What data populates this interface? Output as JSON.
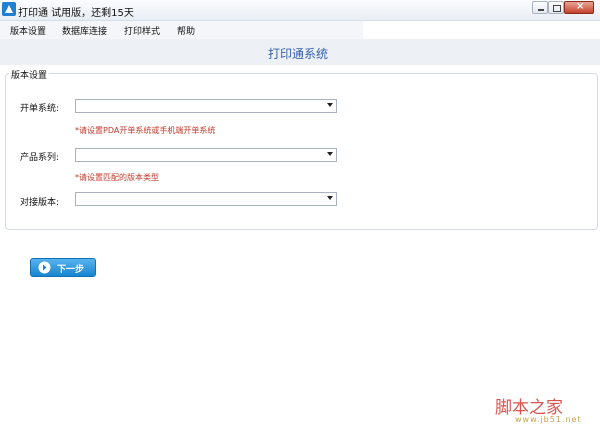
{
  "window": {
    "title": "打印通  试用版，还剩15天",
    "icon": "app-logo-icon",
    "controls": {
      "minimize": "minimize-icon",
      "maximize": "maximize-icon",
      "close": "×"
    }
  },
  "menu": {
    "items": [
      {
        "label": "版本设置"
      },
      {
        "label": "数据库连接"
      },
      {
        "label": "打印样式"
      },
      {
        "label": "帮助"
      }
    ]
  },
  "header": {
    "title": "打印通系统"
  },
  "version_settings": {
    "legend": "版本设置",
    "fields": [
      {
        "label": "开单系统:",
        "value": "",
        "hint": "*请设置PDA开单系统或手机端开单系统"
      },
      {
        "label": "产品系列:",
        "value": "",
        "hint": "*请设置匹配的版本类型"
      },
      {
        "label": "对接版本:",
        "value": ""
      }
    ]
  },
  "actions": {
    "next_label": "下一步",
    "next_icon": "arrow-right-circle-icon"
  },
  "watermark": {
    "brand": "脚本之家",
    "url": "www.jb51.net"
  },
  "colors": {
    "accent": "#1784d0",
    "title": "#3561b3",
    "hint": "#c0392b"
  }
}
